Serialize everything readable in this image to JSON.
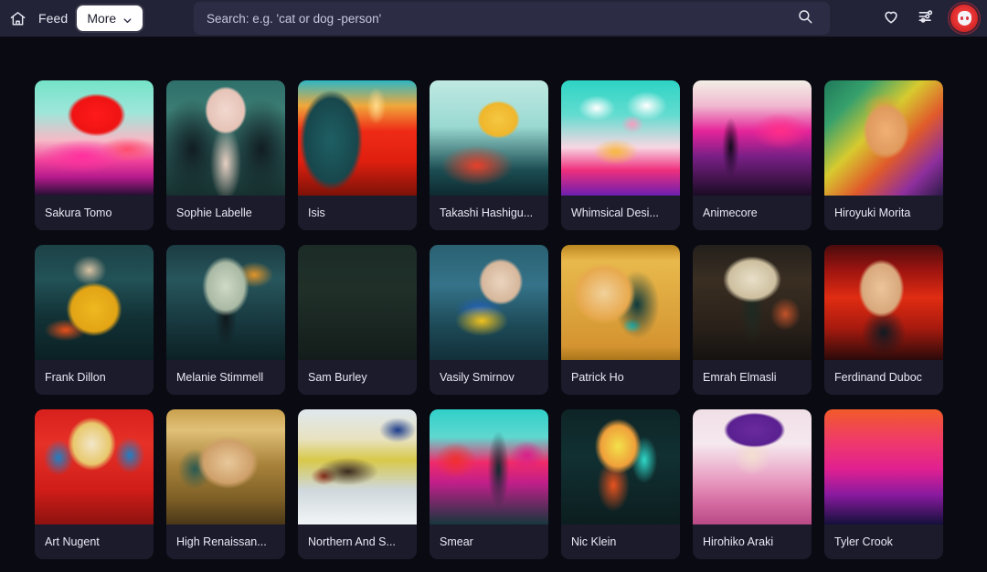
{
  "header": {
    "home_icon": "home-icon",
    "feed_label": "Feed",
    "more_label": "More",
    "more_chevron_icon": "chevron-down-icon",
    "search_placeholder": "Search: e.g. 'cat or dog -person'",
    "search_value": "",
    "search_icon": "search-icon",
    "favorites_icon": "heart-icon",
    "settings_icon": "sliders-icon",
    "avatar_icon": "user-avatar",
    "bar_color": "#232338",
    "search_field_color": "#2c2c45",
    "more_button_color": "#ffffff",
    "avatar_color": "#e02d2d"
  },
  "page": {
    "background_color": "#0a0a12",
    "card_background_color": "#171726",
    "card_label_background_color": "#1b1b2c",
    "text_color": "#e9eaf4"
  },
  "grid": {
    "columns": 7,
    "cards": [
      {
        "label": "Sakura Tomo",
        "art": "linear-gradient(180deg,#74e3c8 0%,#9fe6da 28%,#f6b9c6 52%,#f0419a 70%,#b61a8d 84%,#241033 100%)",
        "art2": "radial-gradient(ellipse 34% 26% at 52% 30%, #ff1a1a 0%, #ef1313 60%, rgba(239,19,19,0) 72%), radial-gradient(ellipse 48% 20% at 40% 66%, #ff2f9e 0%, rgba(255,47,158,0) 75%), radial-gradient(ellipse 30% 14% at 78% 60%, #ff4d6d 0%, rgba(255,77,109,0) 78%)"
      },
      {
        "label": "Sophie Labelle",
        "art": "linear-gradient(180deg,#2e6f6a 0%,#3b7d74 25%,#2c5f5c 60%,#16302f 100%)",
        "art2": "radial-gradient(ellipse 22% 26% at 50% 26%, #f2d8cf 0%, #e6c3b7 70%, rgba(230,195,183,0) 80%), radial-gradient(ellipse 16% 40% at 50% 72%, #e8cfc2 0%, rgba(232,207,194,0) 82%), radial-gradient(ellipse 40% 60% at 22% 60%, #111d22 0%, rgba(17,29,34,0) 74%), radial-gradient(ellipse 40% 60% at 80% 60%, #111d22 0%, rgba(17,29,34,0) 74%)"
      },
      {
        "label": "Isis",
        "art": "linear-gradient(180deg,#2fb6c4 0%,#f0a83a 22%,#ef2b16 44%,#e01f0f 70%,#7d1208 100%)",
        "art2": "radial-gradient(ellipse 34% 56% at 28% 52%, #1e5f63 0%, #17474d 65%, rgba(23,71,77,0) 78%), radial-gradient(ellipse 10% 20% at 66% 22%, #ffd98a 0%, rgba(255,217,138,0) 80%)"
      },
      {
        "label": "Takashi Hashigu...",
        "art": "linear-gradient(180deg,#bfe9e2 0%,#9ad9d2 40%,#1b4d52 78%,#0e2a30 100%)",
        "art2": "radial-gradient(ellipse 22% 20% at 58% 34%, #f5c842 0%, #efb62c 70%, rgba(239,182,44,0) 82%), radial-gradient(ellipse 38% 22% at 40% 74%, #e8402a 0%, rgba(232,64,42,0) 80%)"
      },
      {
        "label": "Whimsical Desi...",
        "art": "linear-gradient(180deg,#2dd4c4 0%,#63dcd0 30%,#f7d7e3 58%,#ef2f7d 78%,#6d1fb0 100%)",
        "art2": "radial-gradient(ellipse 20% 14% at 30% 24%, #ffffff 0%, rgba(255,255,255,0) 78%), radial-gradient(ellipse 22% 16% at 72% 22%, #ffffff 0%, rgba(255,255,255,0) 78%), radial-gradient(ellipse 12% 10% at 60% 38%, #f59ec0 0%, rgba(245,158,192,0) 80%), radial-gradient(ellipse 24% 14% at 46% 62%, #f7b83f 0%, rgba(247,184,63,0) 80%)"
      },
      {
        "label": "Animecore",
        "art": "linear-gradient(180deg,#f3efe6 0%,#f0b9d0 22%,#e5249a 44%,#7a1f86 66%,#1a0c24 100%)",
        "art2": "radial-gradient(ellipse 10% 36% at 32% 58%, #120a1c 0%, rgba(18,10,28,0) 72%), radial-gradient(ellipse 30% 20% at 74% 44%, #ff2e88 0%, rgba(255,46,136,0) 80%)"
      },
      {
        "label": "Hiroyuki Morita",
        "art": "linear-gradient(135deg,#1f7a5a 0%,#36a06c 20%,#d7ca2f 42%,#e05a2b 62%,#8e2f9e 82%,#2b1a46 100%)",
        "art2": "radial-gradient(ellipse 26% 32% at 52% 44%, #f0b074 0%, #e09a5e 62%, rgba(224,154,94,0) 76%), radial-gradient(ellipse 22% 16% at 50% 24%, #d8a23c 0%, rgba(216,162,60,0) 80%)"
      },
      {
        "label": "Frank Dillon",
        "art": "linear-gradient(180deg,#1c4247 0%,#225257 30%,#123236 62%,#0b2024 100%)",
        "art2": "radial-gradient(ellipse 30% 30% at 50% 56%, #efb820 0%, #e2a415 64%, rgba(226,164,21,0) 78%), radial-gradient(ellipse 18% 16% at 46% 22%, #d9c3a4 0%, rgba(217,195,164,0) 80%), radial-gradient(ellipse 22% 12% at 26% 74%, #e8501a 0%, rgba(232,80,26,0) 80%)"
      },
      {
        "label": "Melanie Stimmell",
        "art": "linear-gradient(180deg,#1b3c42 0%,#27565c 30%,#16363c 70%,#0c2024 100%)",
        "art2": "radial-gradient(ellipse 26% 34% at 50% 36%, #cfd9c6 0%, #a9b9a4 60%, rgba(169,185,164,0) 76%), radial-gradient(ellipse 12% 34% at 50% 64%, #10181c 0%, rgba(16,24,28,0) 78%), radial-gradient(ellipse 20% 14% at 74% 26%, #e0942a 0%, rgba(224,148,42,0) 80%)"
      },
      {
        "label": "Sam Burley",
        "art": "linear-gradient(180deg,#1c2b26 0%,#203029 40%,#131c1a 100%)",
        "art2": "radial-gradient(circle 30% at 50% 32%, #f0aa1e 0%, #e79c13 62%, rgba(231,156,19,0) 72%), radial-gradient(ellipse 14% 22% at 50% 40%, #e6d3be 0%, rgba(230,211,190,0) 80%), radial-gradient(ellipse 16% 28% at 50% 74%, #0d1412 0%, rgba(13,20,18,0) 78%)"
      },
      {
        "label": "Vasily Smirnov",
        "art": "linear-gradient(180deg,#2a6172 0%,#35738a 35%,#1d4a57 70%,#12303a 100%)",
        "art2": "radial-gradient(ellipse 24% 26% at 60% 32%, #ead4be 0%, #d6b79c 66%, rgba(214,183,156,0) 78%), radial-gradient(ellipse 30% 18% at 44% 66%, #f0c21e 0%, rgba(240,194,30,0) 74%), radial-gradient(ellipse 26% 14% at 42% 56%, #2060c0 0%, rgba(32,96,192,0) 78%)"
      },
      {
        "label": "Patrick Ho",
        "art": "linear-gradient(180deg,#b8861f 0%,#d8a43a 8%,#e8b94c 14%,#d49431 88%,#a9741a 100%)",
        "art2": "radial-gradient(ellipse 34% 34% at 36% 42%, #f0d09a 0%, #e8a94e 64%, rgba(232,169,78,0) 78%), radial-gradient(ellipse 24% 38% at 64% 52%, #0f3a3c 0%, rgba(15,58,60,0) 78%), radial-gradient(ellipse 10% 8% at 60% 70%, #22e0d8 0%, rgba(34,224,216,0) 82%)"
      },
      {
        "label": "Emrah Elmasli",
        "art": "linear-gradient(180deg,#23201b 0%,#3a2e22 30%,#2a211a 70%,#151210 100%)",
        "art2": "radial-gradient(ellipse 34% 28% at 50% 30%, #e9e0c9 0%, #cdbf9f 58%, rgba(205,191,159,0) 72%), radial-gradient(ellipse 14% 40% at 50% 56%, #1d2a22 0%, rgba(29,42,34,0) 76%), radial-gradient(ellipse 16% 18% at 78% 60%, #c0522a 0%, rgba(192,82,42,0) 80%)"
      },
      {
        "label": "Ferdinand Duboc",
        "art": "linear-gradient(180deg,#4a0c0c 0%,#9e1410 22%,#e02c12 46%,#a81a0e 72%,#2a0a0a 100%)",
        "art2": "radial-gradient(ellipse 26% 34% at 48% 38%, #ecc49a 0%, #d8a87c 62%, rgba(216,168,124,0) 74%), radial-gradient(ellipse 24% 26% at 50% 76%, #0f1a22 0%, rgba(15,26,34,0) 78%)"
      },
      {
        "label": "Art Nugent",
        "art": "linear-gradient(180deg,#d8201c 0%,#e63128 30%,#d01d18 70%,#8c120f 100%)",
        "art2": "radial-gradient(ellipse 30% 34% at 48% 30%, #f2e6c8 0%, #e8c86c 52%, rgba(232,200,108,0) 68%), radial-gradient(ellipse 16% 20% at 20% 42%, #1f7fc4 0%, rgba(31,127,196,0) 78%), radial-gradient(ellipse 16% 20% at 80% 40%, #1f7fc4 0%, rgba(31,127,196,0) 78%)"
      },
      {
        "label": "High Renaissan...",
        "art": "linear-gradient(180deg,#c9a14e 0%,#e0c077 18%,#a8823a 48%,#7d5f26 78%,#4a3718 100%)",
        "art2": "radial-gradient(ellipse 34% 30% at 52% 46%, #e8c89a 0%, #cfa06a 60%, rgba(207,160,106,0) 76%), radial-gradient(ellipse 18% 22% at 24% 52%, #2a5a52 0%, rgba(42,90,82,0) 80%)"
      },
      {
        "label": "Northern And S...",
        "art": "linear-gradient(180deg,#dfe8ee 0%,#e8e2c0 26%,#d8c84a 44%,#cfd8dd 70%,#f2f5f7 100%)",
        "art2": "radial-gradient(ellipse 20% 14% at 84% 18%, #1a3a8a 0%, rgba(26,58,138,0) 78%), radial-gradient(ellipse 34% 16% at 42% 54%, #3a2a1e 0%, rgba(58,42,30,0) 76%), radial-gradient(ellipse 14% 10% at 22% 58%, #8a2a1a 0%, rgba(138,42,26,0) 80%)"
      },
      {
        "label": "Smear",
        "art": "linear-gradient(180deg,#2fd0c8 0%,#5fd8d0 24%,#f02a6a 46%,#c01f8a 64%,#17363c 100%)",
        "art2": "radial-gradient(ellipse 12% 44% at 58% 52%, #0f2a30 0%, rgba(15,42,48,0) 76%), radial-gradient(ellipse 22% 20% at 22% 44%, #f03030 0%, rgba(240,48,48,0) 78%), radial-gradient(ellipse 18% 16% at 82% 40%, #d8208a 0%, rgba(216,32,138,0) 80%)"
      },
      {
        "label": "Nic Klein",
        "art": "linear-gradient(180deg,#0e2426 0%,#113032 40%,#0c1d1f 100%)",
        "art2": "radial-gradient(ellipse 28% 34% at 48% 32%, #f2e04a 0%, #f0a03a 52%, rgba(240,160,58,0) 70%), radial-gradient(ellipse 18% 30% at 44% 66%, #e8521e 0%, rgba(232,82,30,0) 76%), radial-gradient(ellipse 14% 26% at 70% 44%, #2fd8c8 0%, rgba(47,216,200,0) 78%)"
      },
      {
        "label": "Hirohiko Araki",
        "art": "linear-gradient(180deg,#f0dfe6 0%,#f5e8ee 30%,#e89ac0 62%,#d46aa0 82%,#b84a86 100%)",
        "art2": "radial-gradient(ellipse 34% 20% at 52% 18%, #6a2a9e 0%, #5a2090 66%, rgba(90,32,144,0) 76%), radial-gradient(ellipse 20% 22% at 50% 40%, #f3ddd0 0%, rgba(243,221,208,0) 80%)"
      },
      {
        "label": "Tyler Crook",
        "art": "linear-gradient(180deg,#f25a2a 0%,#ef3a6a 28%,#e02090 52%,#8a1aa0 74%,#14103a 100%)",
        "art2": "radial-gradient(circle 20% at 50% 26%, #f6efdc 0%, #eadfc0 64%, rgba(234,223,192,0) 74%), radial-gradient(ellipse 18% 38% at 50% 64%, #15312e 0%, rgba(21,49,46,0) 76%), radial-gradient(ellipse 30% 14% at 50% 92%, #ef2060 0%, rgba(239,32,96,0) 80%)"
      }
    ]
  }
}
